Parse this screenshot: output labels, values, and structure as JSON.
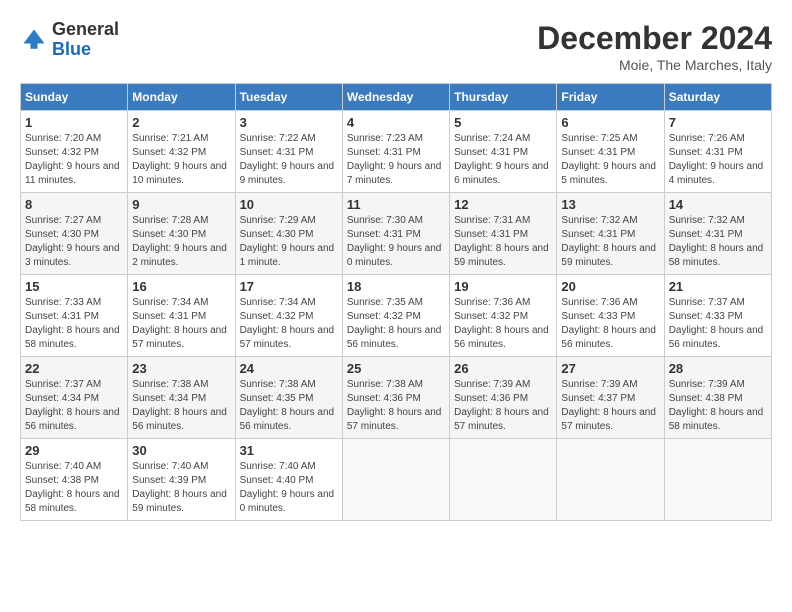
{
  "logo": {
    "general": "General",
    "blue": "Blue"
  },
  "header": {
    "month": "December 2024",
    "location": "Moie, The Marches, Italy"
  },
  "weekdays": [
    "Sunday",
    "Monday",
    "Tuesday",
    "Wednesday",
    "Thursday",
    "Friday",
    "Saturday"
  ],
  "weeks": [
    [
      {
        "day": "1",
        "sunrise": "7:20 AM",
        "sunset": "4:32 PM",
        "daylight": "9 hours and 11 minutes."
      },
      {
        "day": "2",
        "sunrise": "7:21 AM",
        "sunset": "4:32 PM",
        "daylight": "9 hours and 10 minutes."
      },
      {
        "day": "3",
        "sunrise": "7:22 AM",
        "sunset": "4:31 PM",
        "daylight": "9 hours and 9 minutes."
      },
      {
        "day": "4",
        "sunrise": "7:23 AM",
        "sunset": "4:31 PM",
        "daylight": "9 hours and 7 minutes."
      },
      {
        "day": "5",
        "sunrise": "7:24 AM",
        "sunset": "4:31 PM",
        "daylight": "9 hours and 6 minutes."
      },
      {
        "day": "6",
        "sunrise": "7:25 AM",
        "sunset": "4:31 PM",
        "daylight": "9 hours and 5 minutes."
      },
      {
        "day": "7",
        "sunrise": "7:26 AM",
        "sunset": "4:31 PM",
        "daylight": "9 hours and 4 minutes."
      }
    ],
    [
      {
        "day": "8",
        "sunrise": "7:27 AM",
        "sunset": "4:30 PM",
        "daylight": "9 hours and 3 minutes."
      },
      {
        "day": "9",
        "sunrise": "7:28 AM",
        "sunset": "4:30 PM",
        "daylight": "9 hours and 2 minutes."
      },
      {
        "day": "10",
        "sunrise": "7:29 AM",
        "sunset": "4:30 PM",
        "daylight": "9 hours and 1 minute."
      },
      {
        "day": "11",
        "sunrise": "7:30 AM",
        "sunset": "4:31 PM",
        "daylight": "9 hours and 0 minutes."
      },
      {
        "day": "12",
        "sunrise": "7:31 AM",
        "sunset": "4:31 PM",
        "daylight": "8 hours and 59 minutes."
      },
      {
        "day": "13",
        "sunrise": "7:32 AM",
        "sunset": "4:31 PM",
        "daylight": "8 hours and 59 minutes."
      },
      {
        "day": "14",
        "sunrise": "7:32 AM",
        "sunset": "4:31 PM",
        "daylight": "8 hours and 58 minutes."
      }
    ],
    [
      {
        "day": "15",
        "sunrise": "7:33 AM",
        "sunset": "4:31 PM",
        "daylight": "8 hours and 58 minutes."
      },
      {
        "day": "16",
        "sunrise": "7:34 AM",
        "sunset": "4:31 PM",
        "daylight": "8 hours and 57 minutes."
      },
      {
        "day": "17",
        "sunrise": "7:34 AM",
        "sunset": "4:32 PM",
        "daylight": "8 hours and 57 minutes."
      },
      {
        "day": "18",
        "sunrise": "7:35 AM",
        "sunset": "4:32 PM",
        "daylight": "8 hours and 56 minutes."
      },
      {
        "day": "19",
        "sunrise": "7:36 AM",
        "sunset": "4:32 PM",
        "daylight": "8 hours and 56 minutes."
      },
      {
        "day": "20",
        "sunrise": "7:36 AM",
        "sunset": "4:33 PM",
        "daylight": "8 hours and 56 minutes."
      },
      {
        "day": "21",
        "sunrise": "7:37 AM",
        "sunset": "4:33 PM",
        "daylight": "8 hours and 56 minutes."
      }
    ],
    [
      {
        "day": "22",
        "sunrise": "7:37 AM",
        "sunset": "4:34 PM",
        "daylight": "8 hours and 56 minutes."
      },
      {
        "day": "23",
        "sunrise": "7:38 AM",
        "sunset": "4:34 PM",
        "daylight": "8 hours and 56 minutes."
      },
      {
        "day": "24",
        "sunrise": "7:38 AM",
        "sunset": "4:35 PM",
        "daylight": "8 hours and 56 minutes."
      },
      {
        "day": "25",
        "sunrise": "7:38 AM",
        "sunset": "4:36 PM",
        "daylight": "8 hours and 57 minutes."
      },
      {
        "day": "26",
        "sunrise": "7:39 AM",
        "sunset": "4:36 PM",
        "daylight": "8 hours and 57 minutes."
      },
      {
        "day": "27",
        "sunrise": "7:39 AM",
        "sunset": "4:37 PM",
        "daylight": "8 hours and 57 minutes."
      },
      {
        "day": "28",
        "sunrise": "7:39 AM",
        "sunset": "4:38 PM",
        "daylight": "8 hours and 58 minutes."
      }
    ],
    [
      {
        "day": "29",
        "sunrise": "7:40 AM",
        "sunset": "4:38 PM",
        "daylight": "8 hours and 58 minutes."
      },
      {
        "day": "30",
        "sunrise": "7:40 AM",
        "sunset": "4:39 PM",
        "daylight": "8 hours and 59 minutes."
      },
      {
        "day": "31",
        "sunrise": "7:40 AM",
        "sunset": "4:40 PM",
        "daylight": "9 hours and 0 minutes."
      },
      null,
      null,
      null,
      null
    ]
  ]
}
